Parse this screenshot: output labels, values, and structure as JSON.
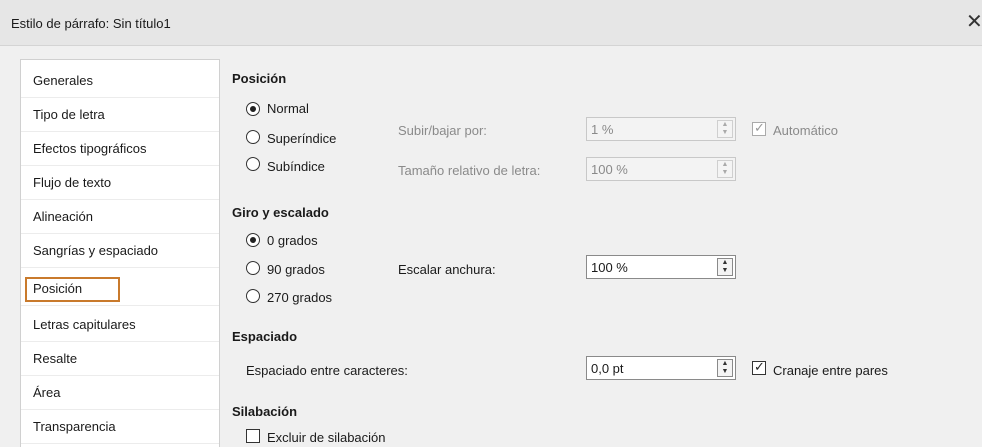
{
  "window": {
    "title": "Estilo de párrafo: Sin título1",
    "close_glyph": "✕"
  },
  "sidebar": {
    "items": [
      {
        "label": "Generales"
      },
      {
        "label": "Tipo de letra"
      },
      {
        "label": "Efectos tipográficos"
      },
      {
        "label": "Flujo de texto"
      },
      {
        "label": "Alineación"
      },
      {
        "label": "Sangrías y espaciado"
      },
      {
        "label": "Posición",
        "selected": true
      },
      {
        "label": "Letras capitulares"
      },
      {
        "label": "Resalte"
      },
      {
        "label": "Área"
      },
      {
        "label": "Transparencia"
      }
    ]
  },
  "position": {
    "heading": "Posición",
    "options": [
      {
        "label": "Normal",
        "checked": true
      },
      {
        "label": "Superíndice",
        "checked": false
      },
      {
        "label": "Subíndice",
        "checked": false
      }
    ],
    "raise_lower_label": "Subir/bajar por:",
    "raise_lower_value": "1 %",
    "automatic_label": "Automático",
    "automatic_checked": true,
    "relative_size_label": "Tamaño relativo de letra:",
    "relative_size_value": "100 %"
  },
  "rotation": {
    "heading": "Giro y escalado",
    "options": [
      {
        "label": "0 grados",
        "checked": true
      },
      {
        "label": "90 grados",
        "checked": false
      },
      {
        "label": "270 grados",
        "checked": false
      }
    ],
    "scale_width_label": "Escalar anchura:",
    "scale_width_value": "100 %"
  },
  "spacing": {
    "heading": "Espaciado",
    "char_spacing_label": "Espaciado entre caracteres:",
    "char_spacing_value": "0,0 pt",
    "pair_kerning_label": "Cranaje entre pares",
    "pair_kerning_checked": true
  },
  "hyphenation": {
    "heading": "Silabación",
    "exclude_label": "Excluir de silabación",
    "exclude_checked": false
  },
  "colors": {
    "selection_border": "#c97a2c"
  }
}
